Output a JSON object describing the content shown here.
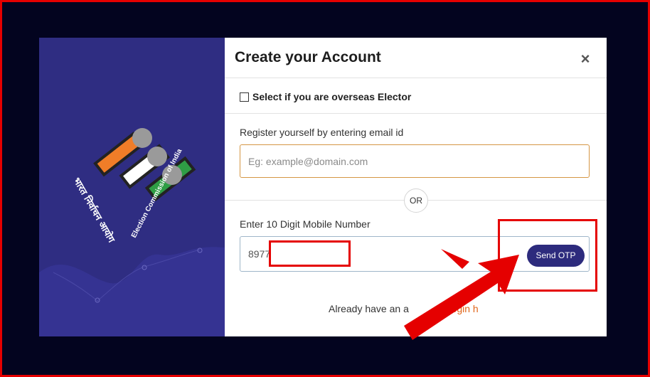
{
  "modal": {
    "title": "Create your Account",
    "close_label": "×",
    "overseas_label": "Select if you are overseas Elector",
    "email_label": "Register yourself by entering email id",
    "email_placeholder": "Eg: example@domain.com",
    "or_label": "OR",
    "mobile_label": "Enter 10 Digit Mobile Number",
    "mobile_value": "8977",
    "send_otp_label": "Send OTP",
    "footer_text": "Already have an a",
    "login_link": "Login h"
  },
  "logo": {
    "hindi_text": "भारत निर्वाचन आयोग",
    "english_text": "Election Commission of India"
  },
  "colors": {
    "panel_bg": "#2f2d82",
    "accent_button": "#2d2b7d",
    "saffron": "#f07d28",
    "green": "#2f9e45",
    "annotation_red": "#e50000",
    "link_orange": "#e0661b"
  }
}
